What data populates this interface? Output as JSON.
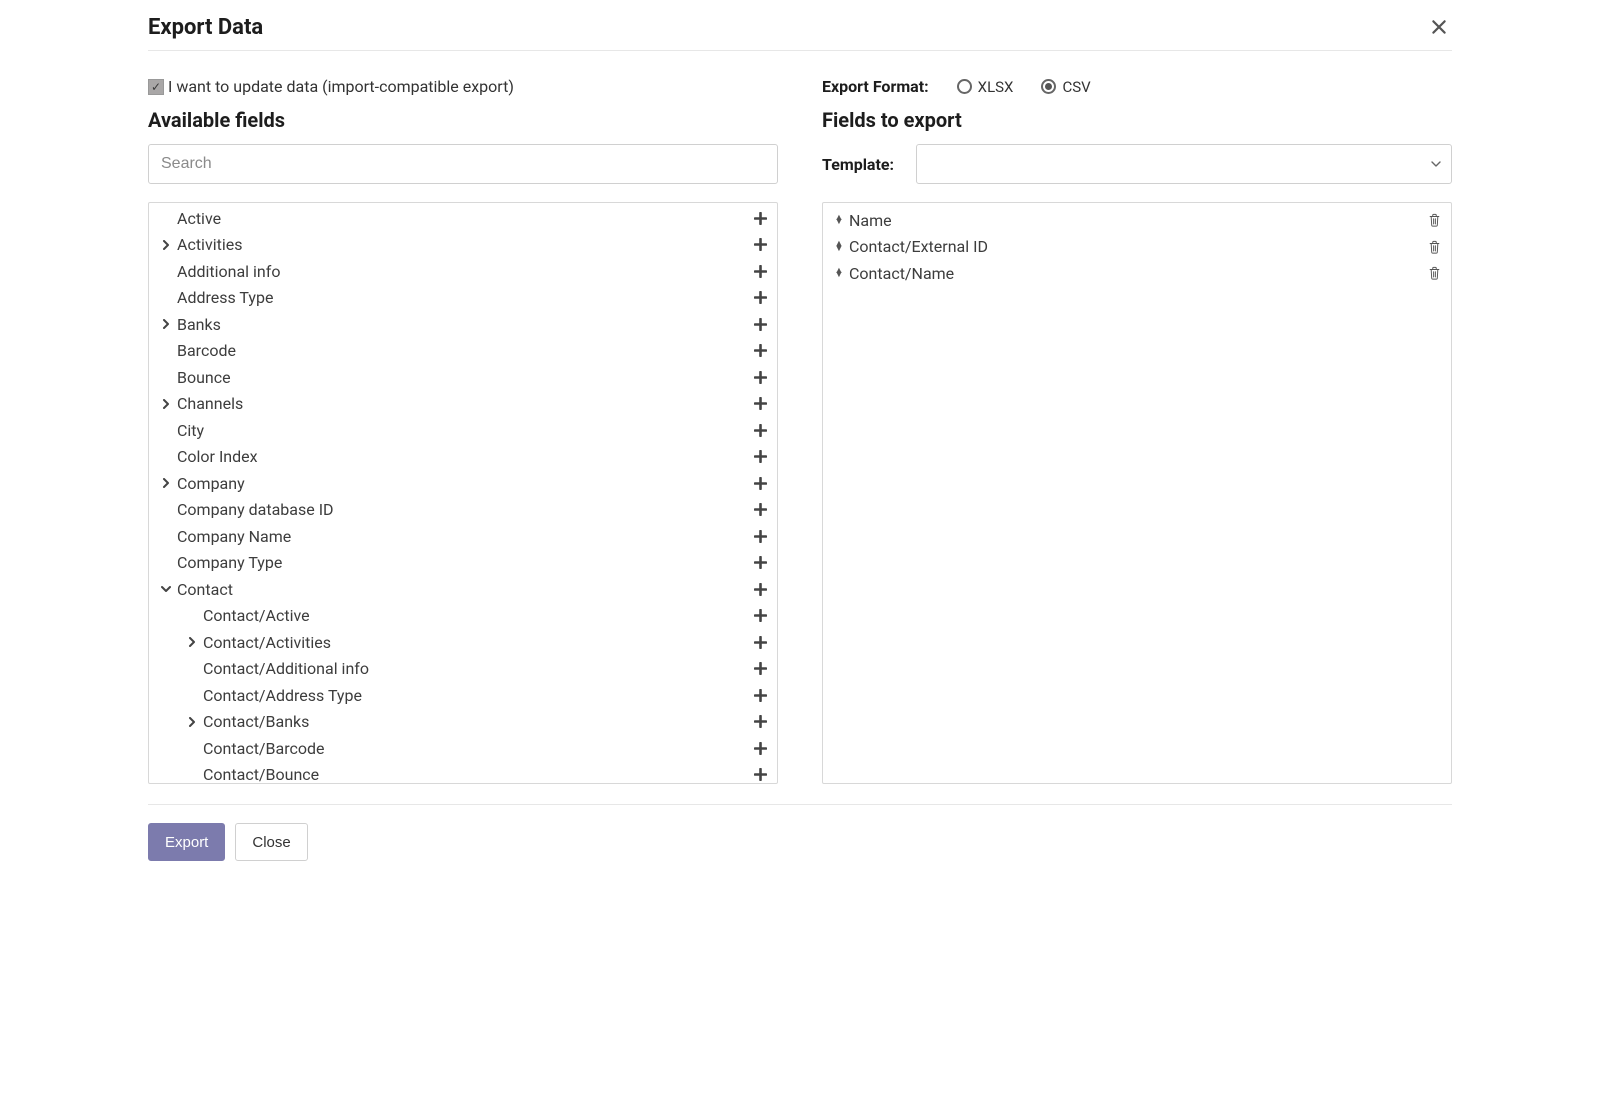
{
  "modal_title": "Export Data",
  "close_icon": "close-icon",
  "update_check": {
    "checked": true,
    "label": "I want to update data (import-compatible export)"
  },
  "left": {
    "section_title": "Available fields",
    "search_placeholder": "Search",
    "tree": [
      {
        "label": "Active",
        "expandable": false,
        "expanded": false,
        "depth": 0
      },
      {
        "label": "Activities",
        "expandable": true,
        "expanded": false,
        "depth": 0
      },
      {
        "label": "Additional info",
        "expandable": false,
        "expanded": false,
        "depth": 0
      },
      {
        "label": "Address Type",
        "expandable": false,
        "expanded": false,
        "depth": 0
      },
      {
        "label": "Banks",
        "expandable": true,
        "expanded": false,
        "depth": 0
      },
      {
        "label": "Barcode",
        "expandable": false,
        "expanded": false,
        "depth": 0
      },
      {
        "label": "Bounce",
        "expandable": false,
        "expanded": false,
        "depth": 0
      },
      {
        "label": "Channels",
        "expandable": true,
        "expanded": false,
        "depth": 0
      },
      {
        "label": "City",
        "expandable": false,
        "expanded": false,
        "depth": 0
      },
      {
        "label": "Color Index",
        "expandable": false,
        "expanded": false,
        "depth": 0
      },
      {
        "label": "Company",
        "expandable": true,
        "expanded": false,
        "depth": 0
      },
      {
        "label": "Company database ID",
        "expandable": false,
        "expanded": false,
        "depth": 0
      },
      {
        "label": "Company Name",
        "expandable": false,
        "expanded": false,
        "depth": 0
      },
      {
        "label": "Company Type",
        "expandable": false,
        "expanded": false,
        "depth": 0
      },
      {
        "label": "Contact",
        "expandable": true,
        "expanded": true,
        "depth": 0
      },
      {
        "label": "Contact/Active",
        "expandable": false,
        "expanded": false,
        "depth": 1
      },
      {
        "label": "Contact/Activities",
        "expandable": true,
        "expanded": false,
        "depth": 1
      },
      {
        "label": "Contact/Additional info",
        "expandable": false,
        "expanded": false,
        "depth": 1
      },
      {
        "label": "Contact/Address Type",
        "expandable": false,
        "expanded": false,
        "depth": 1
      },
      {
        "label": "Contact/Banks",
        "expandable": true,
        "expanded": false,
        "depth": 1
      },
      {
        "label": "Contact/Barcode",
        "expandable": false,
        "expanded": false,
        "depth": 1
      },
      {
        "label": "Contact/Bounce",
        "expandable": false,
        "expanded": false,
        "depth": 1
      }
    ]
  },
  "right": {
    "format_label": "Export Format:",
    "formats": [
      {
        "label": "XLSX",
        "checked": false
      },
      {
        "label": "CSV",
        "checked": true
      }
    ],
    "section_title": "Fields to export",
    "template_label": "Template:",
    "template_value": "",
    "fields": [
      {
        "label": "Name"
      },
      {
        "label": "Contact/External ID"
      },
      {
        "label": "Contact/Name"
      }
    ]
  },
  "footer": {
    "export_label": "Export",
    "close_label": "Close"
  }
}
